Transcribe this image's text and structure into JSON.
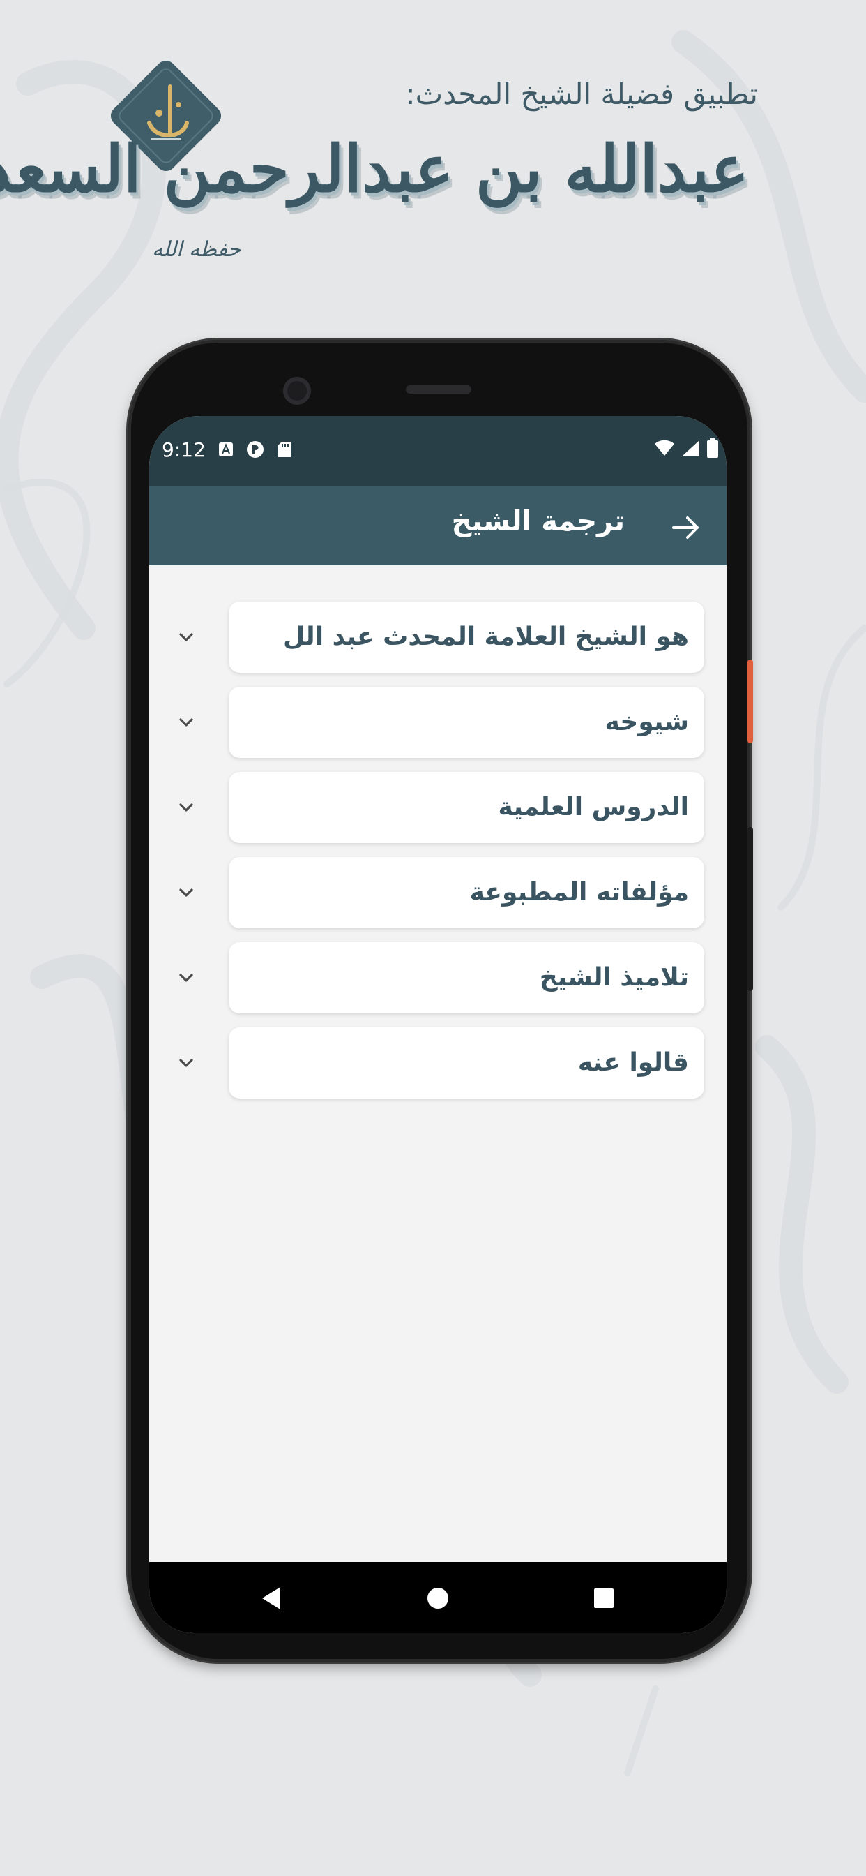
{
  "promo": {
    "subtitle": "تطبيق فضيلة الشيخ المحدث:",
    "title": "عبدالله بن عبدالرحمن السعد",
    "honorific": "حفظه الله"
  },
  "status_bar": {
    "time": "9:12"
  },
  "app_bar": {
    "title": "ترجمة الشيخ",
    "back_icon": "arrow-forward-icon"
  },
  "sections": [
    {
      "label": "هو الشيخ العلامة المحدث عبد الل",
      "icon": "chevron-down-icon"
    },
    {
      "label": "شيوخه",
      "icon": "chevron-down-icon"
    },
    {
      "label": "الدروس العلمية",
      "icon": "chevron-down-icon"
    },
    {
      "label": "مؤلفاته المطبوعة",
      "icon": "chevron-down-icon"
    },
    {
      "label": "تلاميذ الشيخ",
      "icon": "chevron-down-icon"
    },
    {
      "label": "قالوا عنه",
      "icon": "chevron-down-icon"
    }
  ],
  "colors": {
    "status_bar": "#283f47",
    "app_bar": "#3b5b66",
    "text_accent": "#3a5561",
    "screen_bg": "#f3f3f3"
  }
}
